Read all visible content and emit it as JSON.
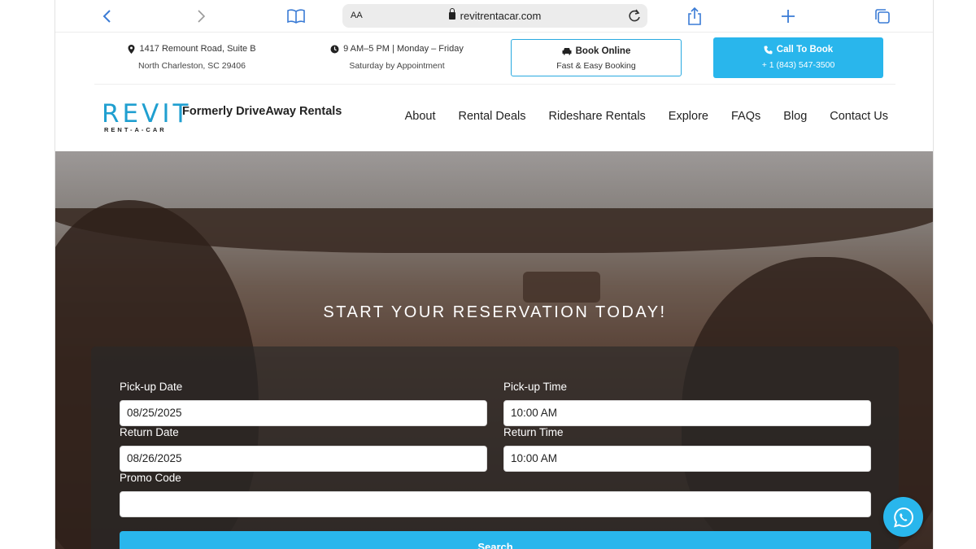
{
  "browser": {
    "aa_label": "AA",
    "url": "revitrentacar.com"
  },
  "infobar": {
    "address_line1": "1417 Remount Road, Suite B",
    "address_line2": "North Charleston, SC 29406",
    "hours_line1": "9 AM–5 PM | Monday – Friday",
    "hours_line2": "Saturday by Appointment",
    "book_title": "Book Online",
    "book_sub": "Fast & Easy Booking",
    "call_title": "Call To Book",
    "call_sub": "+ 1 (843) 547-3500"
  },
  "header": {
    "logo_word": "REVIT",
    "logo_sub": "RENT-A-CAR",
    "tagline": "Formerly DriveAway Rentals",
    "nav": [
      "About",
      "Rental Deals",
      "Rideshare Rentals",
      "Explore",
      "FAQs",
      "Blog",
      "Contact Us"
    ]
  },
  "hero": {
    "title": "START YOUR RESERVATION TODAY!"
  },
  "form": {
    "pickup_date_label": "Pick-up Date",
    "pickup_date_value": "08/25/2025",
    "pickup_time_label": "Pick-up Time",
    "pickup_time_value": "10:00 AM",
    "return_date_label": "Return Date",
    "return_date_value": "08/26/2025",
    "return_time_label": "Return Time",
    "return_time_value": "10:00 AM",
    "promo_label": "Promo Code",
    "promo_value": "",
    "search_label": "Search"
  },
  "colors": {
    "accent": "#29b6ec",
    "safari_blue": "#3a7bd5"
  },
  "icons": [
    "back-icon",
    "forward-icon",
    "bookmarks-icon",
    "lock-icon",
    "reload-icon",
    "share-icon",
    "new-tab-icon",
    "tabs-icon",
    "location-pin-icon",
    "clock-icon",
    "car-icon",
    "phone-icon",
    "whatsapp-icon"
  ]
}
